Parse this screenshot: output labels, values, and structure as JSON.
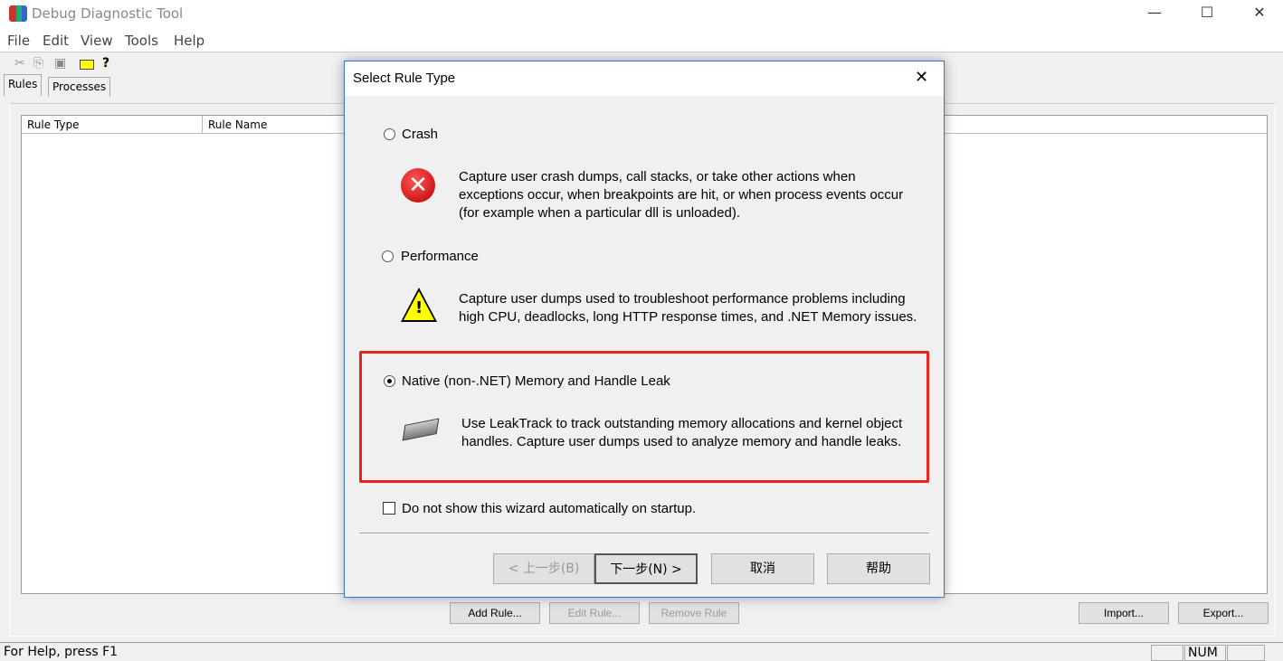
{
  "app": {
    "title": "Debug Diagnostic Tool",
    "icon": "debugdiag-app-icon"
  },
  "window_controls": {
    "minimize": "—",
    "maximize": "☐",
    "close": "✕"
  },
  "menu": [
    "File",
    "Edit",
    "View",
    "Tools",
    "Help"
  ],
  "toolbar": {
    "icons": [
      "cut-icon",
      "copy-icon",
      "paste-icon",
      "open-folder-icon",
      "help-icon"
    ]
  },
  "tabs": [
    {
      "label": "Rules",
      "active": true
    },
    {
      "label": "Processes",
      "active": false
    }
  ],
  "rules_table": {
    "columns": [
      "Rule Type",
      "Rule Name"
    ],
    "rows": []
  },
  "main_buttons": {
    "add": "Add Rule...",
    "edit": "Edit Rule...",
    "remove": "Remove Rule",
    "import": "Import...",
    "export": "Export..."
  },
  "status": {
    "text": "For Help, press F1",
    "num": "NUM"
  },
  "dialog": {
    "title": "Select Rule Type",
    "close": "✕",
    "options": [
      {
        "label": "Crash",
        "selected": false,
        "icon": "error-icon",
        "description": "Capture user crash dumps, call stacks, or take other actions when exceptions occur, when breakpoints are hit, or when process events occur (for example when a particular dll is unloaded)."
      },
      {
        "label": "Performance",
        "selected": false,
        "icon": "warning-icon",
        "description": "Capture user dumps used to troubleshoot performance problems including high CPU, deadlocks, long HTTP response times, and .NET Memory issues."
      },
      {
        "label": "Native (non-.NET) Memory and Handle Leak",
        "selected": true,
        "icon": "memory-chip-icon",
        "description": "Use LeakTrack to track outstanding memory allocations and kernel object handles. Capture user dumps used to analyze memory and handle leaks."
      }
    ],
    "checkbox": {
      "label": "Do not show this wizard automatically on startup.",
      "checked": false
    },
    "buttons": {
      "back": "< 上一步(B)",
      "next": "下一步(N) >",
      "cancel": "取消",
      "help": "帮助"
    },
    "highlight_color": "#e8231f"
  }
}
